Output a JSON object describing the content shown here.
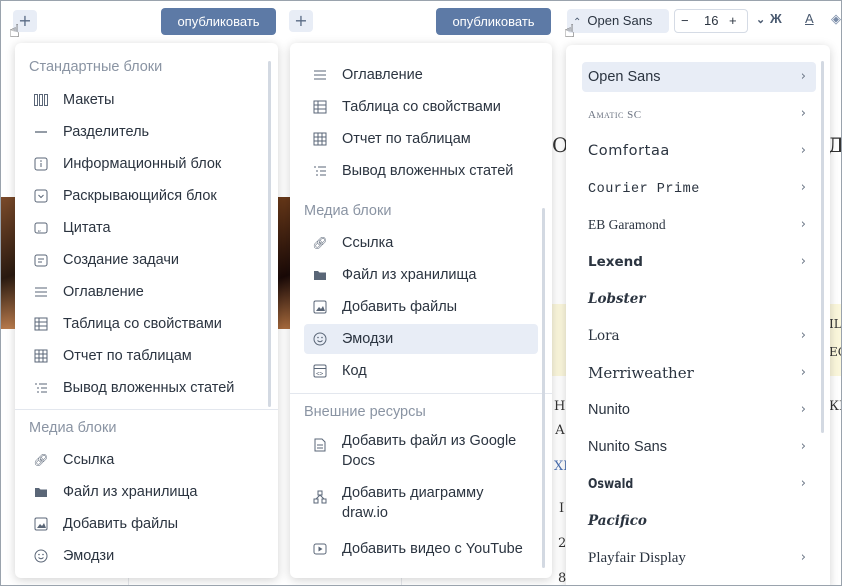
{
  "toolbar": {
    "add_symbol": "+",
    "publish_label": "опубликовать",
    "font_name": "Open Sans",
    "font_size": "16",
    "minus": "−",
    "plus": "+",
    "bold": "Ж",
    "text_color": "A"
  },
  "left_menu": {
    "standard_title": "Стандартные блоки",
    "standard_items": [
      {
        "label": "Макеты",
        "icon": "layout-columns-icon"
      },
      {
        "label": "Разделитель",
        "icon": "divider-line-icon"
      },
      {
        "label": "Информационный блок",
        "icon": "info-box-icon"
      },
      {
        "label": "Раскрывающийся блок",
        "icon": "collapse-box-icon"
      },
      {
        "label": "Цитата",
        "icon": "quote-icon"
      },
      {
        "label": "Создание задачи",
        "icon": "task-icon"
      },
      {
        "label": "Оглавление",
        "icon": "toc-icon"
      },
      {
        "label": "Таблица со свойствами",
        "icon": "table-icon"
      },
      {
        "label": "Отчет по таблицам",
        "icon": "table-report-icon"
      },
      {
        "label": "Вывод вложенных статей",
        "icon": "nested-list-icon"
      }
    ],
    "media_title": "Медиа блоки",
    "media_items": [
      {
        "label": "Ссылка",
        "icon": "link-icon"
      },
      {
        "label": "Файл из хранилища",
        "icon": "folder-icon"
      },
      {
        "label": "Добавить файлы",
        "icon": "image-icon"
      },
      {
        "label": "Эмодзи",
        "icon": "emoji-icon"
      }
    ]
  },
  "middle_menu": {
    "top_items": [
      {
        "label": "Оглавление",
        "icon": "toc-icon"
      },
      {
        "label": "Таблица со свойствами",
        "icon": "table-icon"
      },
      {
        "label": "Отчет по таблицам",
        "icon": "table-report-icon"
      },
      {
        "label": "Вывод вложенных статей",
        "icon": "nested-list-icon"
      }
    ],
    "media_title": "Медиа блоки",
    "media_items": [
      {
        "label": "Ссылка",
        "icon": "link-icon"
      },
      {
        "label": "Файл из хранилища",
        "icon": "folder-icon"
      },
      {
        "label": "Добавить файлы",
        "icon": "image-icon"
      },
      {
        "label": "Эмодзи",
        "icon": "emoji-icon"
      },
      {
        "label": "Код",
        "icon": "code-icon"
      }
    ],
    "external_title": "Внешние ресурсы",
    "external_items": [
      {
        "line1": "Добавить файл из Google",
        "line2": "Docs",
        "icon": "document-icon"
      },
      {
        "line1": "Добавить диаграмму",
        "line2": "draw.io",
        "icon": "diagram-icon"
      },
      {
        "line1": "Добавить видео с YouTube",
        "line2": "",
        "icon": "video-icon"
      }
    ]
  },
  "font_menu": {
    "fonts": [
      "Open Sans",
      "Amatic SC",
      "Comfortaa",
      "Courier Prime",
      "EB Garamond",
      "Lexend",
      "Lobster",
      "Lora",
      "Merriweather",
      "Nunito",
      "Nunito Sans",
      "Oswald",
      "Pacifico",
      "Playfair Display"
    ],
    "selected": "Open Sans"
  },
  "background": {
    "letters": [
      "О",
      "Д",
      "IL",
      "EC",
      "НІ",
      "КІ",
      "А",
      "XI",
      "I",
      "2",
      "8"
    ]
  },
  "colors": {
    "accent": "#5d7aa6",
    "highlight": "#e8edf6",
    "muted_text": "#8a94a3"
  }
}
